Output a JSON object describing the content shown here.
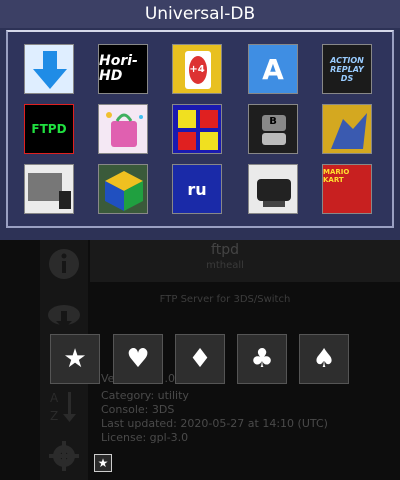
{
  "top": {
    "title": "Universal-DB",
    "tiles": [
      {
        "name": "download-arrow-icon",
        "text": "",
        "bg": "#dfeeff"
      },
      {
        "name": "hori-hd",
        "text": "Hori-HD",
        "bg": "#000000"
      },
      {
        "name": "uno",
        "text": "+4",
        "bg": "#e8c020"
      },
      {
        "name": "a-logo",
        "text": "A",
        "bg": "#3f8ee3"
      },
      {
        "name": "action-replay",
        "text": "ACTION REPLAY DS",
        "bg": "#1b1b1b"
      },
      {
        "name": "ftpd",
        "text": "FTPD",
        "bg": "#000000"
      },
      {
        "name": "shopping-bag",
        "text": "",
        "bg": "#f4e8f4"
      },
      {
        "name": "four-squares",
        "text": "",
        "bg": "#1a1ab0"
      },
      {
        "name": "3ds-b",
        "text": "B",
        "bg": "#1e1e1e"
      },
      {
        "name": "wolf",
        "text": "",
        "bg": "#d4a820"
      },
      {
        "name": "gray-screen",
        "text": "",
        "bg": "#ececec"
      },
      {
        "name": "cube",
        "text": "",
        "bg": "#3a5a3a"
      },
      {
        "name": "ru-dots",
        "text": "ru",
        "bg": "#1a2aa8"
      },
      {
        "name": "console",
        "text": "",
        "bg": "#eaeaea"
      },
      {
        "name": "mario-kart",
        "text": "MARIO KART",
        "bg": "#c82020"
      }
    ]
  },
  "bottom": {
    "app": {
      "title": "ftpd",
      "author": "mtheall",
      "description": "FTP Server for 3DS/Switch"
    },
    "info": {
      "version": "Version: 3.0",
      "version_visible": "Ve",
      "version_tail": ".0",
      "category": "Category: utility",
      "console": "Console: 3DS",
      "updated": "Last updated: 2020-05-27 at 14:10 (UTC)",
      "license": "License: gpl-3.0"
    },
    "sidebar": {
      "icons": [
        "info-icon",
        "cloud-download-icon",
        "sort-az-icon",
        "settings-icon"
      ],
      "sort_label": "A Z"
    },
    "buttons": [
      {
        "name": "star",
        "glyph": "★"
      },
      {
        "name": "heart",
        "glyph": "♥"
      },
      {
        "name": "diamond",
        "glyph": "♦"
      },
      {
        "name": "club",
        "glyph": "♣"
      },
      {
        "name": "spade",
        "glyph": "♠"
      }
    ],
    "mini_star": "★"
  },
  "colors": {
    "top_bg": "#2d3256",
    "bottom_bg": "#0d0d0d"
  }
}
